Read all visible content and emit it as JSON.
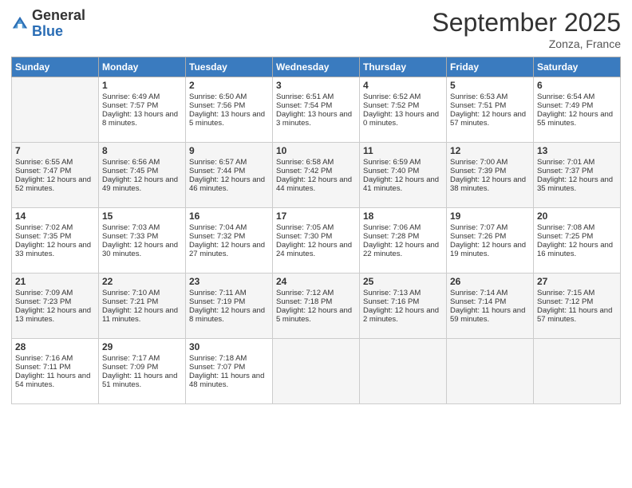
{
  "logo": {
    "general": "General",
    "blue": "Blue"
  },
  "title": "September 2025",
  "subtitle": "Zonza, France",
  "days_header": [
    "Sunday",
    "Monday",
    "Tuesday",
    "Wednesday",
    "Thursday",
    "Friday",
    "Saturday"
  ],
  "weeks": [
    [
      {
        "day": "",
        "sunrise": "",
        "sunset": "",
        "daylight": ""
      },
      {
        "day": "1",
        "sunrise": "Sunrise: 6:49 AM",
        "sunset": "Sunset: 7:57 PM",
        "daylight": "Daylight: 13 hours and 8 minutes."
      },
      {
        "day": "2",
        "sunrise": "Sunrise: 6:50 AM",
        "sunset": "Sunset: 7:56 PM",
        "daylight": "Daylight: 13 hours and 5 minutes."
      },
      {
        "day": "3",
        "sunrise": "Sunrise: 6:51 AM",
        "sunset": "Sunset: 7:54 PM",
        "daylight": "Daylight: 13 hours and 3 minutes."
      },
      {
        "day": "4",
        "sunrise": "Sunrise: 6:52 AM",
        "sunset": "Sunset: 7:52 PM",
        "daylight": "Daylight: 13 hours and 0 minutes."
      },
      {
        "day": "5",
        "sunrise": "Sunrise: 6:53 AM",
        "sunset": "Sunset: 7:51 PM",
        "daylight": "Daylight: 12 hours and 57 minutes."
      },
      {
        "day": "6",
        "sunrise": "Sunrise: 6:54 AM",
        "sunset": "Sunset: 7:49 PM",
        "daylight": "Daylight: 12 hours and 55 minutes."
      }
    ],
    [
      {
        "day": "7",
        "sunrise": "Sunrise: 6:55 AM",
        "sunset": "Sunset: 7:47 PM",
        "daylight": "Daylight: 12 hours and 52 minutes."
      },
      {
        "day": "8",
        "sunrise": "Sunrise: 6:56 AM",
        "sunset": "Sunset: 7:45 PM",
        "daylight": "Daylight: 12 hours and 49 minutes."
      },
      {
        "day": "9",
        "sunrise": "Sunrise: 6:57 AM",
        "sunset": "Sunset: 7:44 PM",
        "daylight": "Daylight: 12 hours and 46 minutes."
      },
      {
        "day": "10",
        "sunrise": "Sunrise: 6:58 AM",
        "sunset": "Sunset: 7:42 PM",
        "daylight": "Daylight: 12 hours and 44 minutes."
      },
      {
        "day": "11",
        "sunrise": "Sunrise: 6:59 AM",
        "sunset": "Sunset: 7:40 PM",
        "daylight": "Daylight: 12 hours and 41 minutes."
      },
      {
        "day": "12",
        "sunrise": "Sunrise: 7:00 AM",
        "sunset": "Sunset: 7:39 PM",
        "daylight": "Daylight: 12 hours and 38 minutes."
      },
      {
        "day": "13",
        "sunrise": "Sunrise: 7:01 AM",
        "sunset": "Sunset: 7:37 PM",
        "daylight": "Daylight: 12 hours and 35 minutes."
      }
    ],
    [
      {
        "day": "14",
        "sunrise": "Sunrise: 7:02 AM",
        "sunset": "Sunset: 7:35 PM",
        "daylight": "Daylight: 12 hours and 33 minutes."
      },
      {
        "day": "15",
        "sunrise": "Sunrise: 7:03 AM",
        "sunset": "Sunset: 7:33 PM",
        "daylight": "Daylight: 12 hours and 30 minutes."
      },
      {
        "day": "16",
        "sunrise": "Sunrise: 7:04 AM",
        "sunset": "Sunset: 7:32 PM",
        "daylight": "Daylight: 12 hours and 27 minutes."
      },
      {
        "day": "17",
        "sunrise": "Sunrise: 7:05 AM",
        "sunset": "Sunset: 7:30 PM",
        "daylight": "Daylight: 12 hours and 24 minutes."
      },
      {
        "day": "18",
        "sunrise": "Sunrise: 7:06 AM",
        "sunset": "Sunset: 7:28 PM",
        "daylight": "Daylight: 12 hours and 22 minutes."
      },
      {
        "day": "19",
        "sunrise": "Sunrise: 7:07 AM",
        "sunset": "Sunset: 7:26 PM",
        "daylight": "Daylight: 12 hours and 19 minutes."
      },
      {
        "day": "20",
        "sunrise": "Sunrise: 7:08 AM",
        "sunset": "Sunset: 7:25 PM",
        "daylight": "Daylight: 12 hours and 16 minutes."
      }
    ],
    [
      {
        "day": "21",
        "sunrise": "Sunrise: 7:09 AM",
        "sunset": "Sunset: 7:23 PM",
        "daylight": "Daylight: 12 hours and 13 minutes."
      },
      {
        "day": "22",
        "sunrise": "Sunrise: 7:10 AM",
        "sunset": "Sunset: 7:21 PM",
        "daylight": "Daylight: 12 hours and 11 minutes."
      },
      {
        "day": "23",
        "sunrise": "Sunrise: 7:11 AM",
        "sunset": "Sunset: 7:19 PM",
        "daylight": "Daylight: 12 hours and 8 minutes."
      },
      {
        "day": "24",
        "sunrise": "Sunrise: 7:12 AM",
        "sunset": "Sunset: 7:18 PM",
        "daylight": "Daylight: 12 hours and 5 minutes."
      },
      {
        "day": "25",
        "sunrise": "Sunrise: 7:13 AM",
        "sunset": "Sunset: 7:16 PM",
        "daylight": "Daylight: 12 hours and 2 minutes."
      },
      {
        "day": "26",
        "sunrise": "Sunrise: 7:14 AM",
        "sunset": "Sunset: 7:14 PM",
        "daylight": "Daylight: 11 hours and 59 minutes."
      },
      {
        "day": "27",
        "sunrise": "Sunrise: 7:15 AM",
        "sunset": "Sunset: 7:12 PM",
        "daylight": "Daylight: 11 hours and 57 minutes."
      }
    ],
    [
      {
        "day": "28",
        "sunrise": "Sunrise: 7:16 AM",
        "sunset": "Sunset: 7:11 PM",
        "daylight": "Daylight: 11 hours and 54 minutes."
      },
      {
        "day": "29",
        "sunrise": "Sunrise: 7:17 AM",
        "sunset": "Sunset: 7:09 PM",
        "daylight": "Daylight: 11 hours and 51 minutes."
      },
      {
        "day": "30",
        "sunrise": "Sunrise: 7:18 AM",
        "sunset": "Sunset: 7:07 PM",
        "daylight": "Daylight: 11 hours and 48 minutes."
      },
      {
        "day": "",
        "sunrise": "",
        "sunset": "",
        "daylight": ""
      },
      {
        "day": "",
        "sunrise": "",
        "sunset": "",
        "daylight": ""
      },
      {
        "day": "",
        "sunrise": "",
        "sunset": "",
        "daylight": ""
      },
      {
        "day": "",
        "sunrise": "",
        "sunset": "",
        "daylight": ""
      }
    ]
  ]
}
